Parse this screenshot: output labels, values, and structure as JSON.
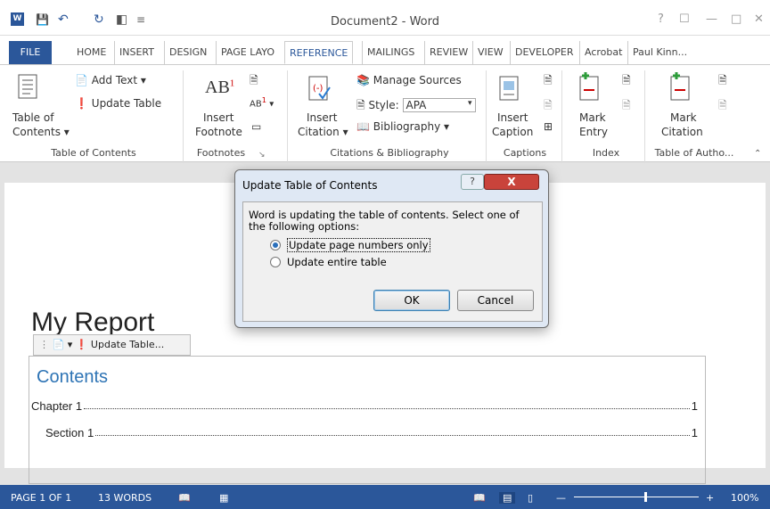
{
  "window": {
    "title": "Document2 - Word",
    "controls": [
      "?",
      "☐",
      "—",
      "□",
      "✕"
    ]
  },
  "tabs": [
    "FILE",
    "HOME",
    "INSERT",
    "DESIGN",
    "PAGE LAYO",
    "REFERENCE",
    "MAILINGS",
    "REVIEW",
    "VIEW",
    "DEVELOPER",
    "Acrobat"
  ],
  "user": "Paul Kinn...",
  "ribbon": {
    "toc_group": {
      "toc_button": "Table of",
      "toc_button_2": "Contents",
      "add_text": "Add Text",
      "update_table": "Update Table",
      "label": "Table of Contents"
    },
    "footnotes_group": {
      "insert_footnote": "Insert",
      "insert_footnote_2": "Footnote",
      "ab_icon": "AB",
      "label": "Footnotes"
    },
    "citations_group": {
      "insert_citation": "Insert",
      "insert_citation_2": "Citation",
      "manage_sources": "Manage Sources",
      "style_label": "Style:",
      "style_value": "APA",
      "bibliography": "Bibliography",
      "label": "Citations & Bibliography"
    },
    "captions_group": {
      "insert_caption": "Insert",
      "insert_caption_2": "Caption",
      "label": "Captions"
    },
    "index_group": {
      "mark_entry": "Mark",
      "mark_entry_2": "Entry",
      "label": "Index"
    },
    "authorities_group": {
      "mark_citation": "Mark",
      "mark_citation_2": "Citation",
      "label": "Table of Autho..."
    }
  },
  "document": {
    "title": "My Report",
    "toc_toolbar_label": "Update Table...",
    "toc_heading": "Contents",
    "toc_entries": [
      {
        "text": "Chapter 1",
        "page": "1"
      },
      {
        "text": "Section 1",
        "page": "1"
      }
    ]
  },
  "dialog": {
    "title": "Update Table of Contents",
    "help": "?",
    "close": "X",
    "message": "Word is updating the table of contents.  Select one of the following options:",
    "options": [
      {
        "label": "Update page numbers only",
        "selected": true
      },
      {
        "label": "Update entire table",
        "selected": false
      }
    ],
    "ok": "OK",
    "cancel": "Cancel"
  },
  "statusbar": {
    "page": "PAGE 1 OF 1",
    "words": "13 WORDS",
    "zoom": "100%"
  },
  "colors": {
    "brand_blue": "#2b579a",
    "heading_blue": "#2e74b5",
    "close_red": "#c9433b"
  }
}
